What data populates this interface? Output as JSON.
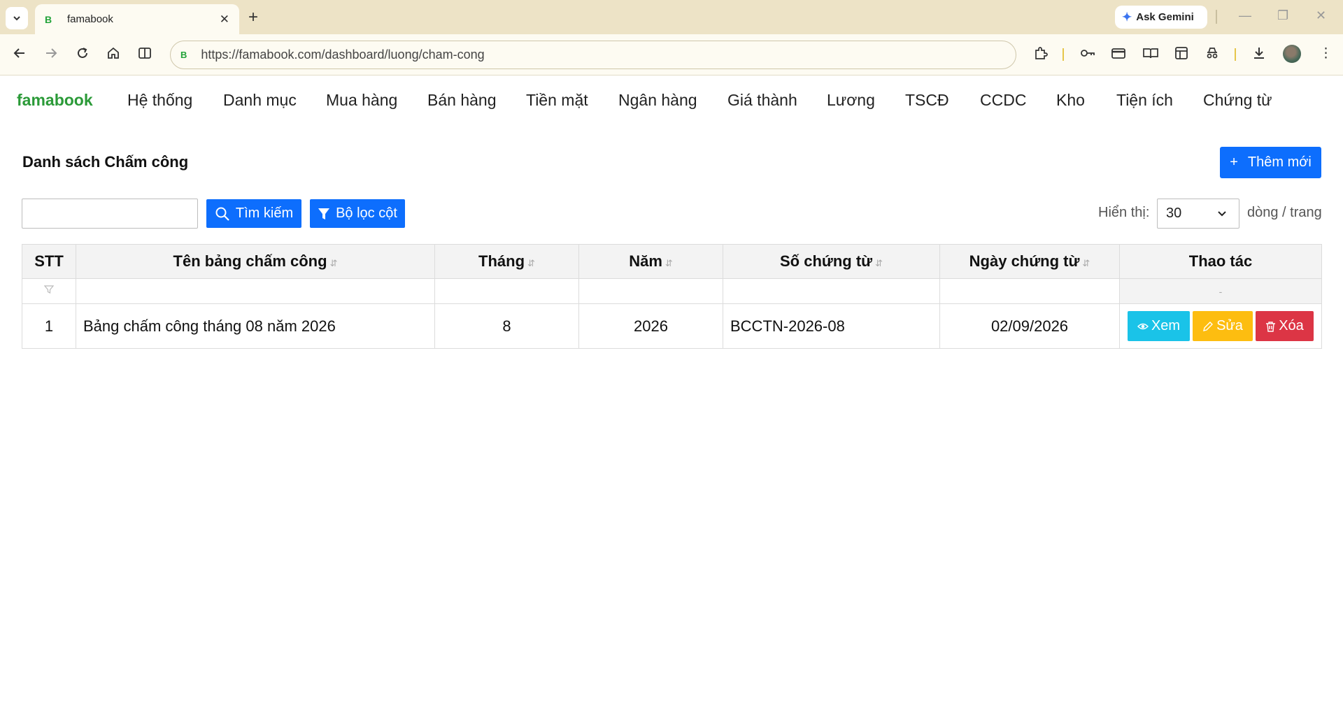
{
  "browser": {
    "tab_title": "famabook",
    "favicon_letter": "B",
    "url": "https://famabook.com/dashboard/luong/cham-cong",
    "gemini_label": "Ask Gemini"
  },
  "app": {
    "brand": "famabook",
    "menu": [
      "Hệ thống",
      "Danh mục",
      "Mua hàng",
      "Bán hàng",
      "Tiền mặt",
      "Ngân hàng",
      "Giá thành",
      "Lương",
      "TSCĐ",
      "CCDC",
      "Kho",
      "Tiện ích",
      "Chứng từ"
    ]
  },
  "page": {
    "title": "Danh sách Chấm công",
    "add_button": "Thêm mới",
    "search_placeholder": "",
    "search_button": "Tìm kiếm",
    "filter_button": "Bộ lọc cột",
    "show_label": "Hiển thị:",
    "page_size": "30",
    "rows_label": "dòng / trang"
  },
  "table": {
    "headers": {
      "stt": "STT",
      "name": "Tên bảng chấm công",
      "month": "Tháng",
      "year": "Năm",
      "doc_no": "Số chứng từ",
      "doc_date": "Ngày chứng từ",
      "actions": "Thao tác"
    },
    "filter_dash": "-",
    "rows": [
      {
        "stt": "1",
        "name": "Bảng chấm công tháng 08 năm 2026",
        "month": "8",
        "year": "2026",
        "doc_no": "BCCTN-2026-08",
        "doc_date": "02/09/2026"
      }
    ],
    "action_labels": {
      "view": "Xem",
      "edit": "Sửa",
      "delete": "Xóa"
    }
  },
  "colors": {
    "primary": "#0d6efd",
    "brand": "#2b9a38",
    "view": "#1ac3e8",
    "edit": "#fdbd10",
    "delete": "#dc3545",
    "chrome": "#ede3c6"
  }
}
